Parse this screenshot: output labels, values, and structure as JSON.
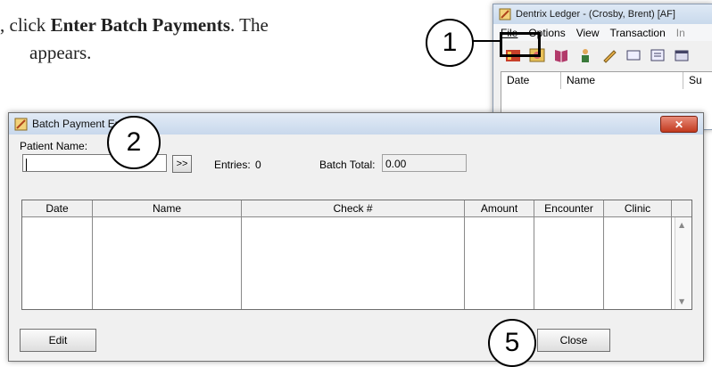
{
  "instructions": {
    "line1_prefix": ", click ",
    "line1_bold": "Enter Batch Payments",
    "line1_suffix": ". The",
    "line2": "appears."
  },
  "ledger": {
    "title": "Dentrix Ledger - (Crosby, Brent) [AF]",
    "menu": [
      "File",
      "Options",
      "View",
      "Transaction",
      "In"
    ],
    "columns": [
      "Date",
      "Name",
      "Su"
    ]
  },
  "callouts": {
    "c1": "1",
    "c2": "2",
    "c5": "5"
  },
  "dialog": {
    "title": "Batch Payment Entry",
    "close_glyph": "✕",
    "patient_name_label": "Patient Name:",
    "patient_name_value": "",
    "arrow_btn": ">>",
    "entries_label": "Entries:",
    "entries_value": "0",
    "batch_total_label": "Batch Total:",
    "batch_total_value": "0.00",
    "columns": [
      "Date",
      "Name",
      "Check #",
      "Amount",
      "Encounter",
      "Clinic"
    ],
    "edit_label": "Edit",
    "close_label": "Close"
  }
}
